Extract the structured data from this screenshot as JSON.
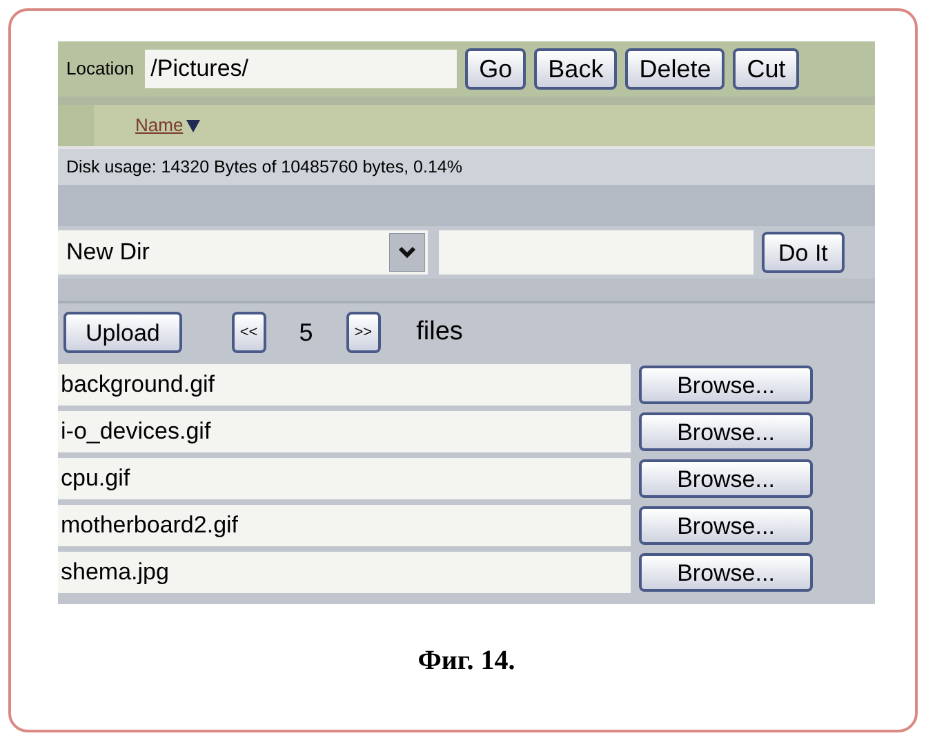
{
  "location": {
    "label": "Location",
    "value": "/Pictures/"
  },
  "toolbar_buttons": [
    "Go",
    "Back",
    "Delete",
    "Cut"
  ],
  "header": {
    "column": "Name",
    "sorted_descending": true
  },
  "disk_usage": "Disk usage: 14320 Bytes of 10485760 bytes, 0.14%",
  "action": {
    "selected": "New Dir",
    "button": "Do It"
  },
  "upload": {
    "button": "Upload",
    "prev": "<<",
    "count": "5",
    "next": ">>",
    "label": "files"
  },
  "files": [
    {
      "name": "background.gif",
      "button": "Browse..."
    },
    {
      "name": "i-o_devices.gif",
      "button": "Browse..."
    },
    {
      "name": "cpu.gif",
      "button": "Browse..."
    },
    {
      "name": "motherboard2.gif",
      "button": "Browse..."
    },
    {
      "name": "shema.jpg",
      "button": "Browse..."
    }
  ],
  "caption": "Фиг. 14."
}
